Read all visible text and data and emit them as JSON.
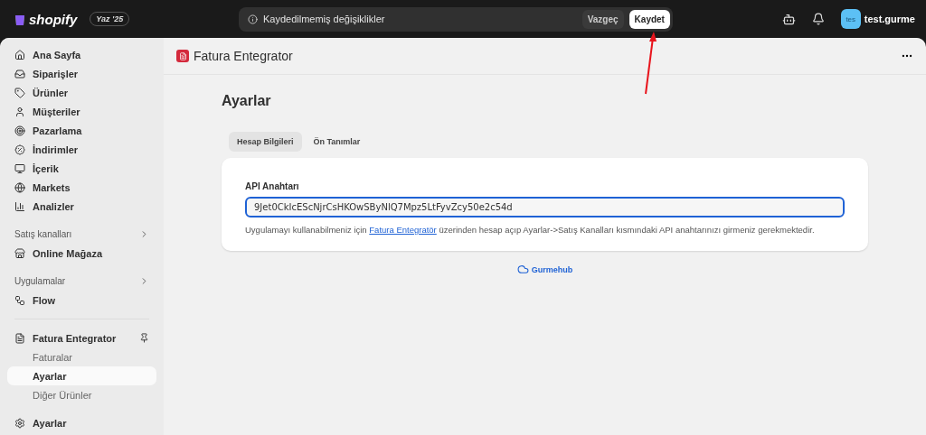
{
  "topbar": {
    "logo": "shopify",
    "edition": "Yaz '25",
    "unsaved": "Kaydedilmemiş değişiklikler",
    "buttons": [
      {
        "kind": "discard",
        "label": "Vazgeç"
      },
      {
        "kind": "save",
        "label": "Kaydet"
      }
    ],
    "avatar": "tes",
    "user": "test.gurme"
  },
  "sidebar": {
    "sections": [
      {
        "items": [
          {
            "kind": "home",
            "label": "Ana Sayfa"
          },
          {
            "kind": "orders",
            "label": "Siparişler"
          },
          {
            "kind": "tag",
            "label": "Ürünler"
          },
          {
            "kind": "person",
            "label": "Müşteriler"
          },
          {
            "kind": "target",
            "label": "Pazarlama"
          },
          {
            "kind": "discount",
            "label": "İndirimler"
          },
          {
            "kind": "content",
            "label": "İçerik"
          },
          {
            "kind": "globe",
            "label": "Markets"
          },
          {
            "kind": "chart",
            "label": "Analizler"
          }
        ]
      },
      {
        "title": "Satış kanalları",
        "items": [
          {
            "kind": "store",
            "label": "Online Mağaza"
          }
        ]
      },
      {
        "title": "Uygulamalar",
        "items": [
          {
            "kind": "flow",
            "label": "Flow"
          }
        ]
      },
      {
        "items": [
          {
            "kind": "app",
            "label": "Fatura Entegrator",
            "pinned": true,
            "children": [
              {
                "label": "Faturalar",
                "selected": false
              },
              {
                "label": "Ayarlar",
                "selected": true
              },
              {
                "label": "Diğer Ürünler",
                "selected": false
              }
            ]
          }
        ]
      },
      {
        "items": [
          {
            "kind": "gear",
            "label": "Ayarlar"
          }
        ]
      }
    ]
  },
  "app_header": {
    "title": "Fatura Entegrator"
  },
  "page": {
    "title": "Ayarlar",
    "tabs": [
      {
        "label": "Hesap Bilgileri",
        "selected": true
      },
      {
        "label": "Ön Tanımlar",
        "selected": false
      }
    ],
    "field": {
      "label": "API Anahtarı",
      "value": "9Jet0CkIcEScNjrCsHKOwSByNlQ7Mpz5LtFyvZcy50e2c54d"
    },
    "help": {
      "before": "Uygulamayı kullanabilmeniz için",
      "link": "Fatura Entegratör",
      "after": "üzerinden hesap açıp Ayarlar->Satış Kanalları kısmındaki API anahtarınızı girmeniz gerekmektedir."
    },
    "footer_brand": "Gurmehub"
  }
}
